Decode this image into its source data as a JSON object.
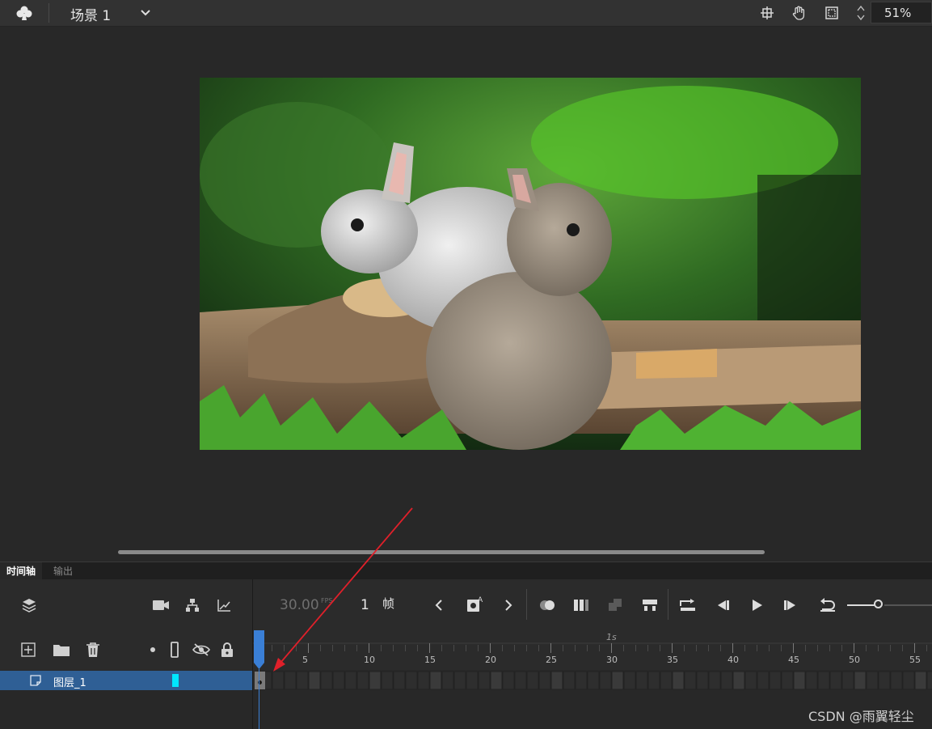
{
  "topbar": {
    "scene_label": "场景 1",
    "zoom": "51%",
    "icons": [
      "club-icon",
      "chevron-down-icon",
      "center-stage-icon",
      "hand-icon",
      "clip-icon",
      "zoom-stepper-icon"
    ]
  },
  "stage": {
    "image_subject": "two rabbits on log"
  },
  "timeline": {
    "tabs": [
      "时间轴",
      "输出"
    ],
    "fps_value": "30.00",
    "fps_unit": "FPS",
    "frame_value": "1",
    "frame_unit": "帧",
    "ruler_marker": "1s",
    "ruler_numbers": [
      "5",
      "10",
      "15",
      "20",
      "25",
      "30",
      "35",
      "40",
      "45",
      "50",
      "55"
    ],
    "layer_name": "图层_1",
    "layer_color": "#00e6ff"
  },
  "watermark": "CSDN @雨翼轻尘",
  "colors": {
    "accent": "#3a7fd6",
    "layer_row": "#2f5f95",
    "annotation_arrow": "#e0202a"
  }
}
